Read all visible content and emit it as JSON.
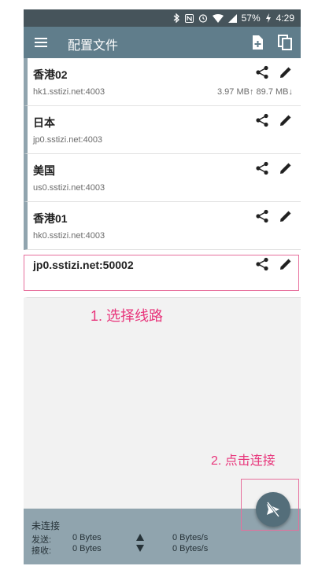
{
  "status_bar": {
    "battery": "57%",
    "time": "4:29"
  },
  "app_bar": {
    "title": "配置文件"
  },
  "profiles": [
    {
      "name": "香港02",
      "host": "hk1.sstizi.net:4003",
      "traffic": "3.97 MB↑ 89.7 MB↓"
    },
    {
      "name": "日本",
      "host": "jp0.sstizi.net:4003",
      "traffic": ""
    },
    {
      "name": "美国",
      "host": "us0.sstizi.net:4003",
      "traffic": ""
    },
    {
      "name": "香港01",
      "host": "hk0.sstizi.net:4003",
      "traffic": ""
    },
    {
      "name": "jp0.sstizi.net:50002",
      "host": "",
      "traffic": ""
    }
  ],
  "annotations": {
    "step1": "1. 选择线路",
    "step2": "2. 点击连接"
  },
  "bottom": {
    "status": "未连接",
    "send_label": "发送:",
    "send_total": "0 Bytes",
    "send_rate": "0 Bytes/s",
    "recv_label": "接收:",
    "recv_total": "0 Bytes",
    "recv_rate": "0 Bytes/s"
  },
  "colors": {
    "app_bar": "#607d8b",
    "status_bar": "#46545b",
    "accent": "#e8357b",
    "bottom_bar": "#90a4ae",
    "fab": "#546e7a"
  }
}
